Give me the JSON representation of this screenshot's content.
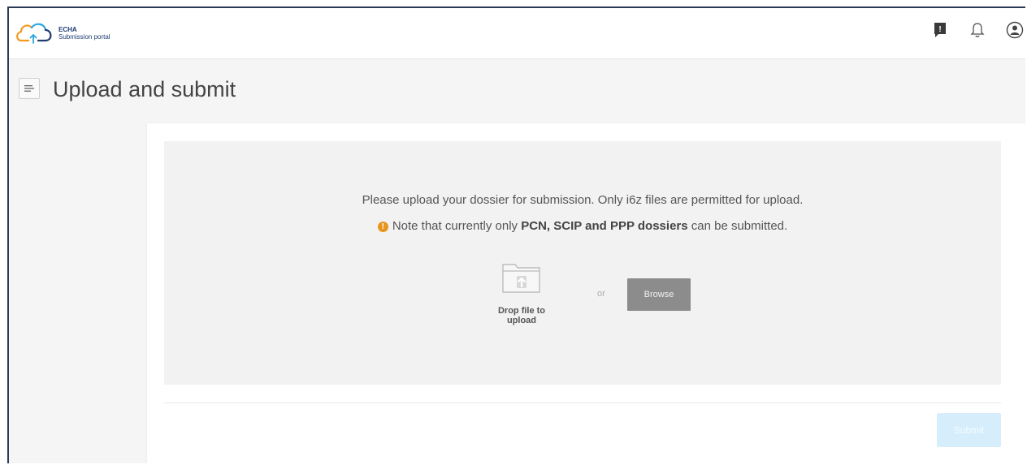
{
  "header": {
    "logo_line1": "ECHA",
    "logo_line2": "Submission portal",
    "icons": [
      "feedback-icon",
      "notification-bell-icon",
      "user-account-icon"
    ]
  },
  "page": {
    "title": "Upload and submit",
    "menu_icon": "menu-toggle-icon"
  },
  "upload": {
    "instructions": "Please upload your dossier for submission. Only i6z files are permitted for upload.",
    "note_prefix": "Note that currently only",
    "note_bold": "PCN, SCIP and PPP dossiers",
    "note_suffix": "can be submitted.",
    "drop_label": "Drop file to upload",
    "or_text": "or",
    "browse_label": "Browse"
  },
  "actions": {
    "submit_label": "Submit"
  },
  "colors": {
    "brand_blue": "#1f3c73",
    "logo_orange": "#f29a1f",
    "logo_cyan": "#2aa6df",
    "warning_orange": "#e8951f",
    "browse_gray": "#8c8c8c",
    "submit_disabled": "#d6eefb"
  }
}
